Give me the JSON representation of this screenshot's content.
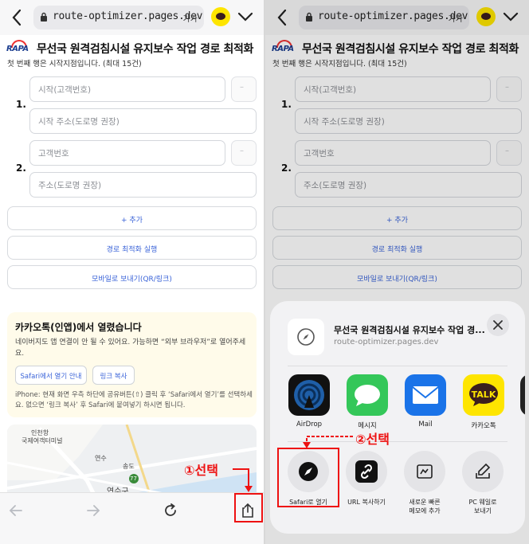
{
  "browser": {
    "url": "route-optimizer.pages.dev",
    "text_size_label": "가가"
  },
  "app": {
    "logo_text": "RAPA",
    "title": "무선국 원격검침시설 유지보수 작업 경로 최적화",
    "subtitle": "첫 번째 행은 시작지점입니다. (최대 15건)"
  },
  "form": {
    "rows": [
      {
        "number": "1.",
        "field1_placeholder": "시작(고객번호)",
        "field2_placeholder": "시작 주소(도로명 권장)",
        "side_button": "–"
      },
      {
        "number": "2.",
        "field1_placeholder": "고객번호",
        "field2_placeholder": "주소(도로명 권장)",
        "side_button": "–"
      }
    ],
    "add_label": "+ 추가",
    "run_label": "경로 최적화 실행",
    "send_label": "모바일로 보내기(QR/링크)"
  },
  "notice": {
    "title": "카카오톡(인앱)에서 열렸습니다",
    "body": "네이버지도 앱 연결이 안 될 수 있어요. 가능하면 “외부 브라우저”로 열어주세요.",
    "button_safari": "Safari에서 열기 안내",
    "button_copy": "링크 복사",
    "footnote": "iPhone: 현재 화면 우측 하단에 공유버튼(⇧) 클릭 후 ‘Safari에서 열기’를 선택하세요. 없으면 ‘링크 복사’ 후 Safari에 붙여넣기 하시면 됩니다."
  },
  "map": {
    "labels": [
      "인천항",
      "국제여객터미널",
      "연수",
      "송도",
      "연수구",
      "77"
    ]
  },
  "annotations": {
    "step1": "①선택",
    "step2": "②선택"
  },
  "share_sheet": {
    "title": "무선국 원격검침시설 유지보수 작업 경...",
    "url": "route-optimizer.pages.dev",
    "apps": [
      {
        "label": "AirDrop",
        "icon": "airdrop-icon"
      },
      {
        "label": "메시지",
        "icon": "messages-icon"
      },
      {
        "label": "Mail",
        "icon": "mail-icon"
      },
      {
        "label": "카카오톡",
        "icon": "kakaotalk-icon",
        "badge": "TALK"
      }
    ],
    "actions": [
      {
        "label": "Safari로 열기",
        "icon": "compass-icon"
      },
      {
        "label": "URL 복사하기",
        "icon": "link-icon"
      },
      {
        "label": "새로운 빠른\n메모에 추가",
        "icon": "quick-note-icon"
      },
      {
        "label": "PC 웨일로\n보내기",
        "icon": "whale-send-icon"
      }
    ]
  },
  "colors": {
    "accent_blue": "#3a63d8",
    "annotation_red": "#e11111",
    "kakao_yellow": "#fee500",
    "notice_bg": "#fffbea"
  }
}
